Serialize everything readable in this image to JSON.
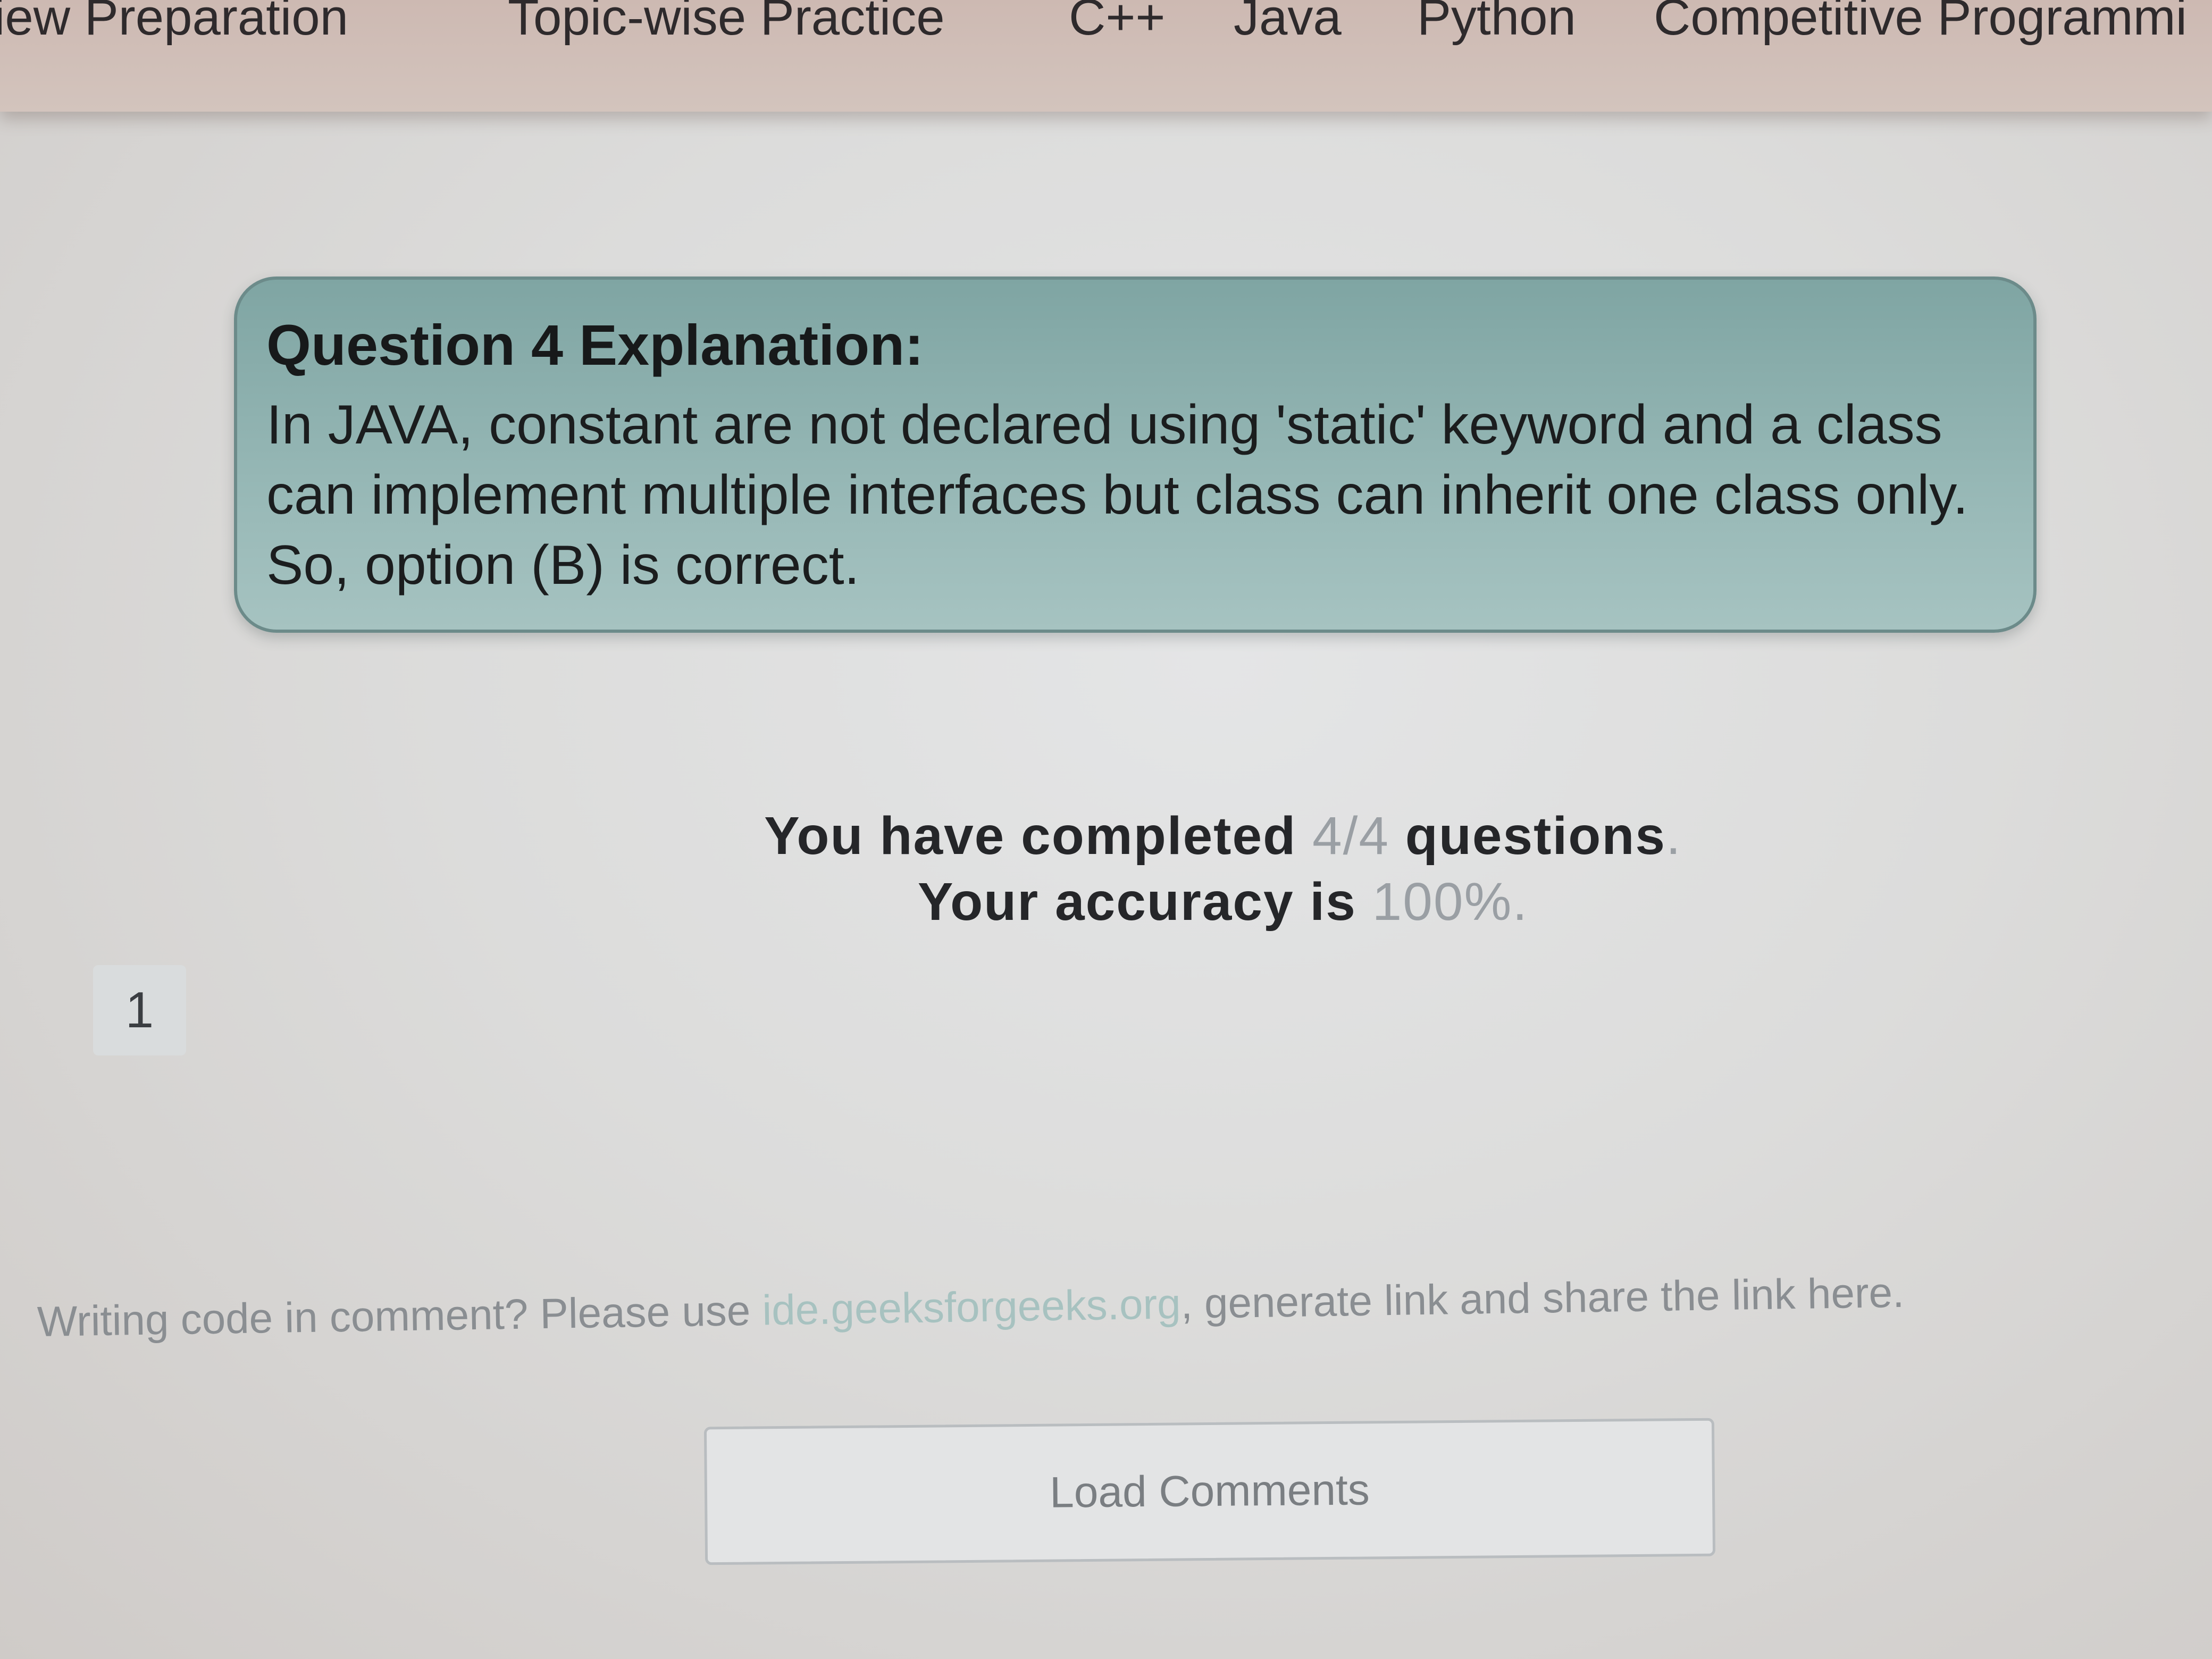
{
  "nav": {
    "items": [
      "view Preparation",
      "Topic-wise Practice",
      "C++",
      "Java",
      "Python",
      "Competitive Programmi"
    ]
  },
  "explanation": {
    "title": "Question 4 Explanation:",
    "body": "In JAVA, constant are not declared using 'static' keyword and a class can implement multiple interfaces but class can inherit one class only. So, option (B) is correct."
  },
  "result": {
    "completed_prefix": "You have completed ",
    "completed_value": "4/4",
    "completed_suffix": " questions",
    "completed_end": ".",
    "accuracy_prefix": "Your accuracy is ",
    "accuracy_value": "100%",
    "accuracy_end": "."
  },
  "pagination": {
    "current": "1"
  },
  "comments": {
    "note_prefix": "Writing code in comment? Please use ",
    "note_link": "ide.geeksforgeeks.org",
    "note_suffix": ", generate link and share the link here.",
    "load_button": "Load Comments"
  },
  "colors": {
    "card_bg": "#97b8b6",
    "link": "#a7c2c0",
    "page_bg": "#dcdcdb"
  }
}
